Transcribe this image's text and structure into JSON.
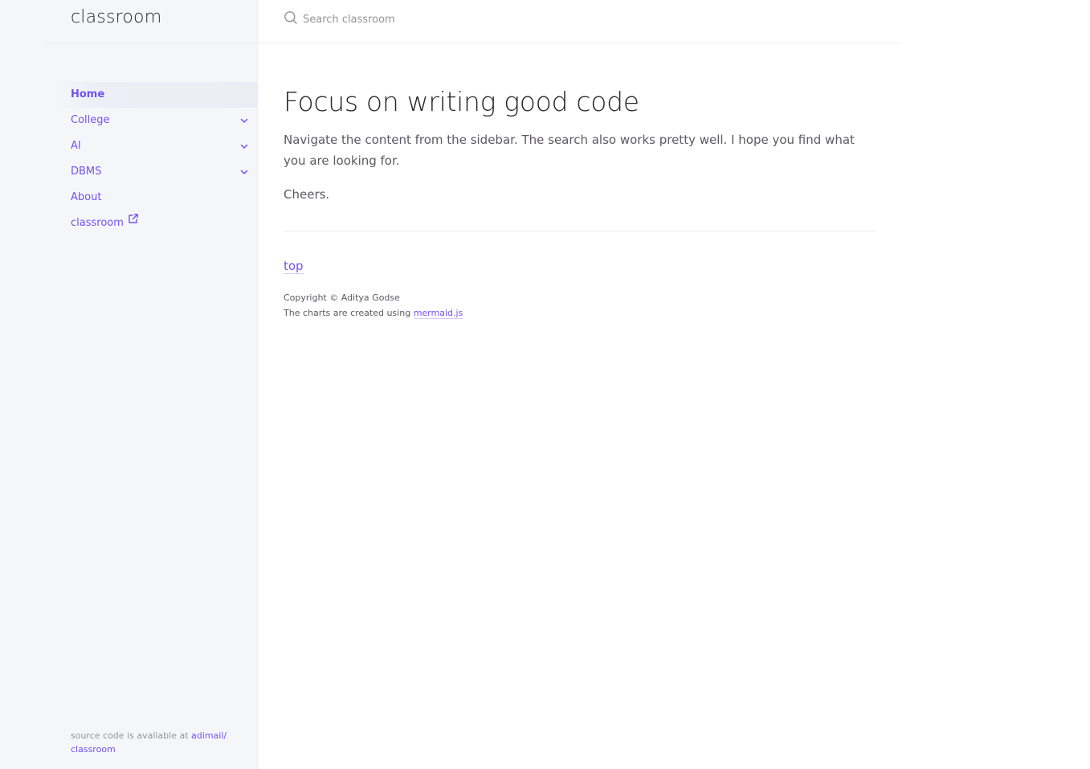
{
  "site": {
    "title": "classroom"
  },
  "search": {
    "placeholder": "Search classroom",
    "value": ""
  },
  "nav": {
    "items": [
      {
        "label": "Home",
        "active": true,
        "expandable": false
      },
      {
        "label": "College",
        "active": false,
        "expandable": true
      },
      {
        "label": "AI",
        "active": false,
        "expandable": true
      },
      {
        "label": "DBMS",
        "active": false,
        "expandable": true
      },
      {
        "label": "About",
        "active": false,
        "expandable": false
      },
      {
        "label": "classroom",
        "active": false,
        "expandable": false,
        "external": true
      }
    ]
  },
  "sidebar_footer": {
    "text": "source code is avaliable at",
    "link_label": "adimail/ classroom"
  },
  "main": {
    "title": "Focus on writing good code",
    "lead": "Navigate the content from the sidebar. The search also works pretty well. I hope you find what you are looking for.",
    "closing": "Cheers."
  },
  "footer": {
    "top_link": "top",
    "copyright": "Copyright © Aditya Godse",
    "charts_prefix": "The charts are created using",
    "charts_link": "mermaid.js"
  },
  "colors": {
    "accent": "#7253ed",
    "sidebar_bg": "#f5f6fa",
    "border": "#eeebee",
    "heading": "#27262b",
    "text": "#5c5962"
  },
  "icons": {
    "search": "search-icon",
    "expander": "chevron-down-icon",
    "external": "external-link-icon"
  }
}
